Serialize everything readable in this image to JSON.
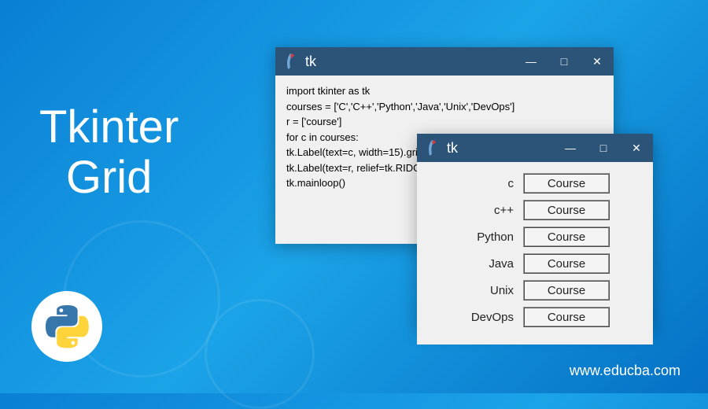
{
  "title_line1": "Tkinter",
  "title_line2": "Grid",
  "website": "www.educba.com",
  "window1": {
    "title": "tk",
    "code": [
      "import tkinter as tk",
      "courses = ['C','C++','Python','Java','Unix','DevOps']",
      "r = ['course']",
      "for c in courses:",
      "tk.Label(text=c, width=15).grid(column=0)",
      "tk.Label(text=r, relief=tk.RIDGE, width=15).grid(column=1)",
      "tk.mainloop()"
    ]
  },
  "window2": {
    "title": "tk",
    "rows": [
      {
        "label": "c",
        "value": "Course"
      },
      {
        "label": "c++",
        "value": "Course"
      },
      {
        "label": "Python",
        "value": "Course"
      },
      {
        "label": "Java",
        "value": "Course"
      },
      {
        "label": "Unix",
        "value": "Course"
      },
      {
        "label": "DevOps",
        "value": "Course"
      }
    ]
  },
  "controls": {
    "minimize": "—",
    "maximize": "□",
    "close": "✕"
  }
}
